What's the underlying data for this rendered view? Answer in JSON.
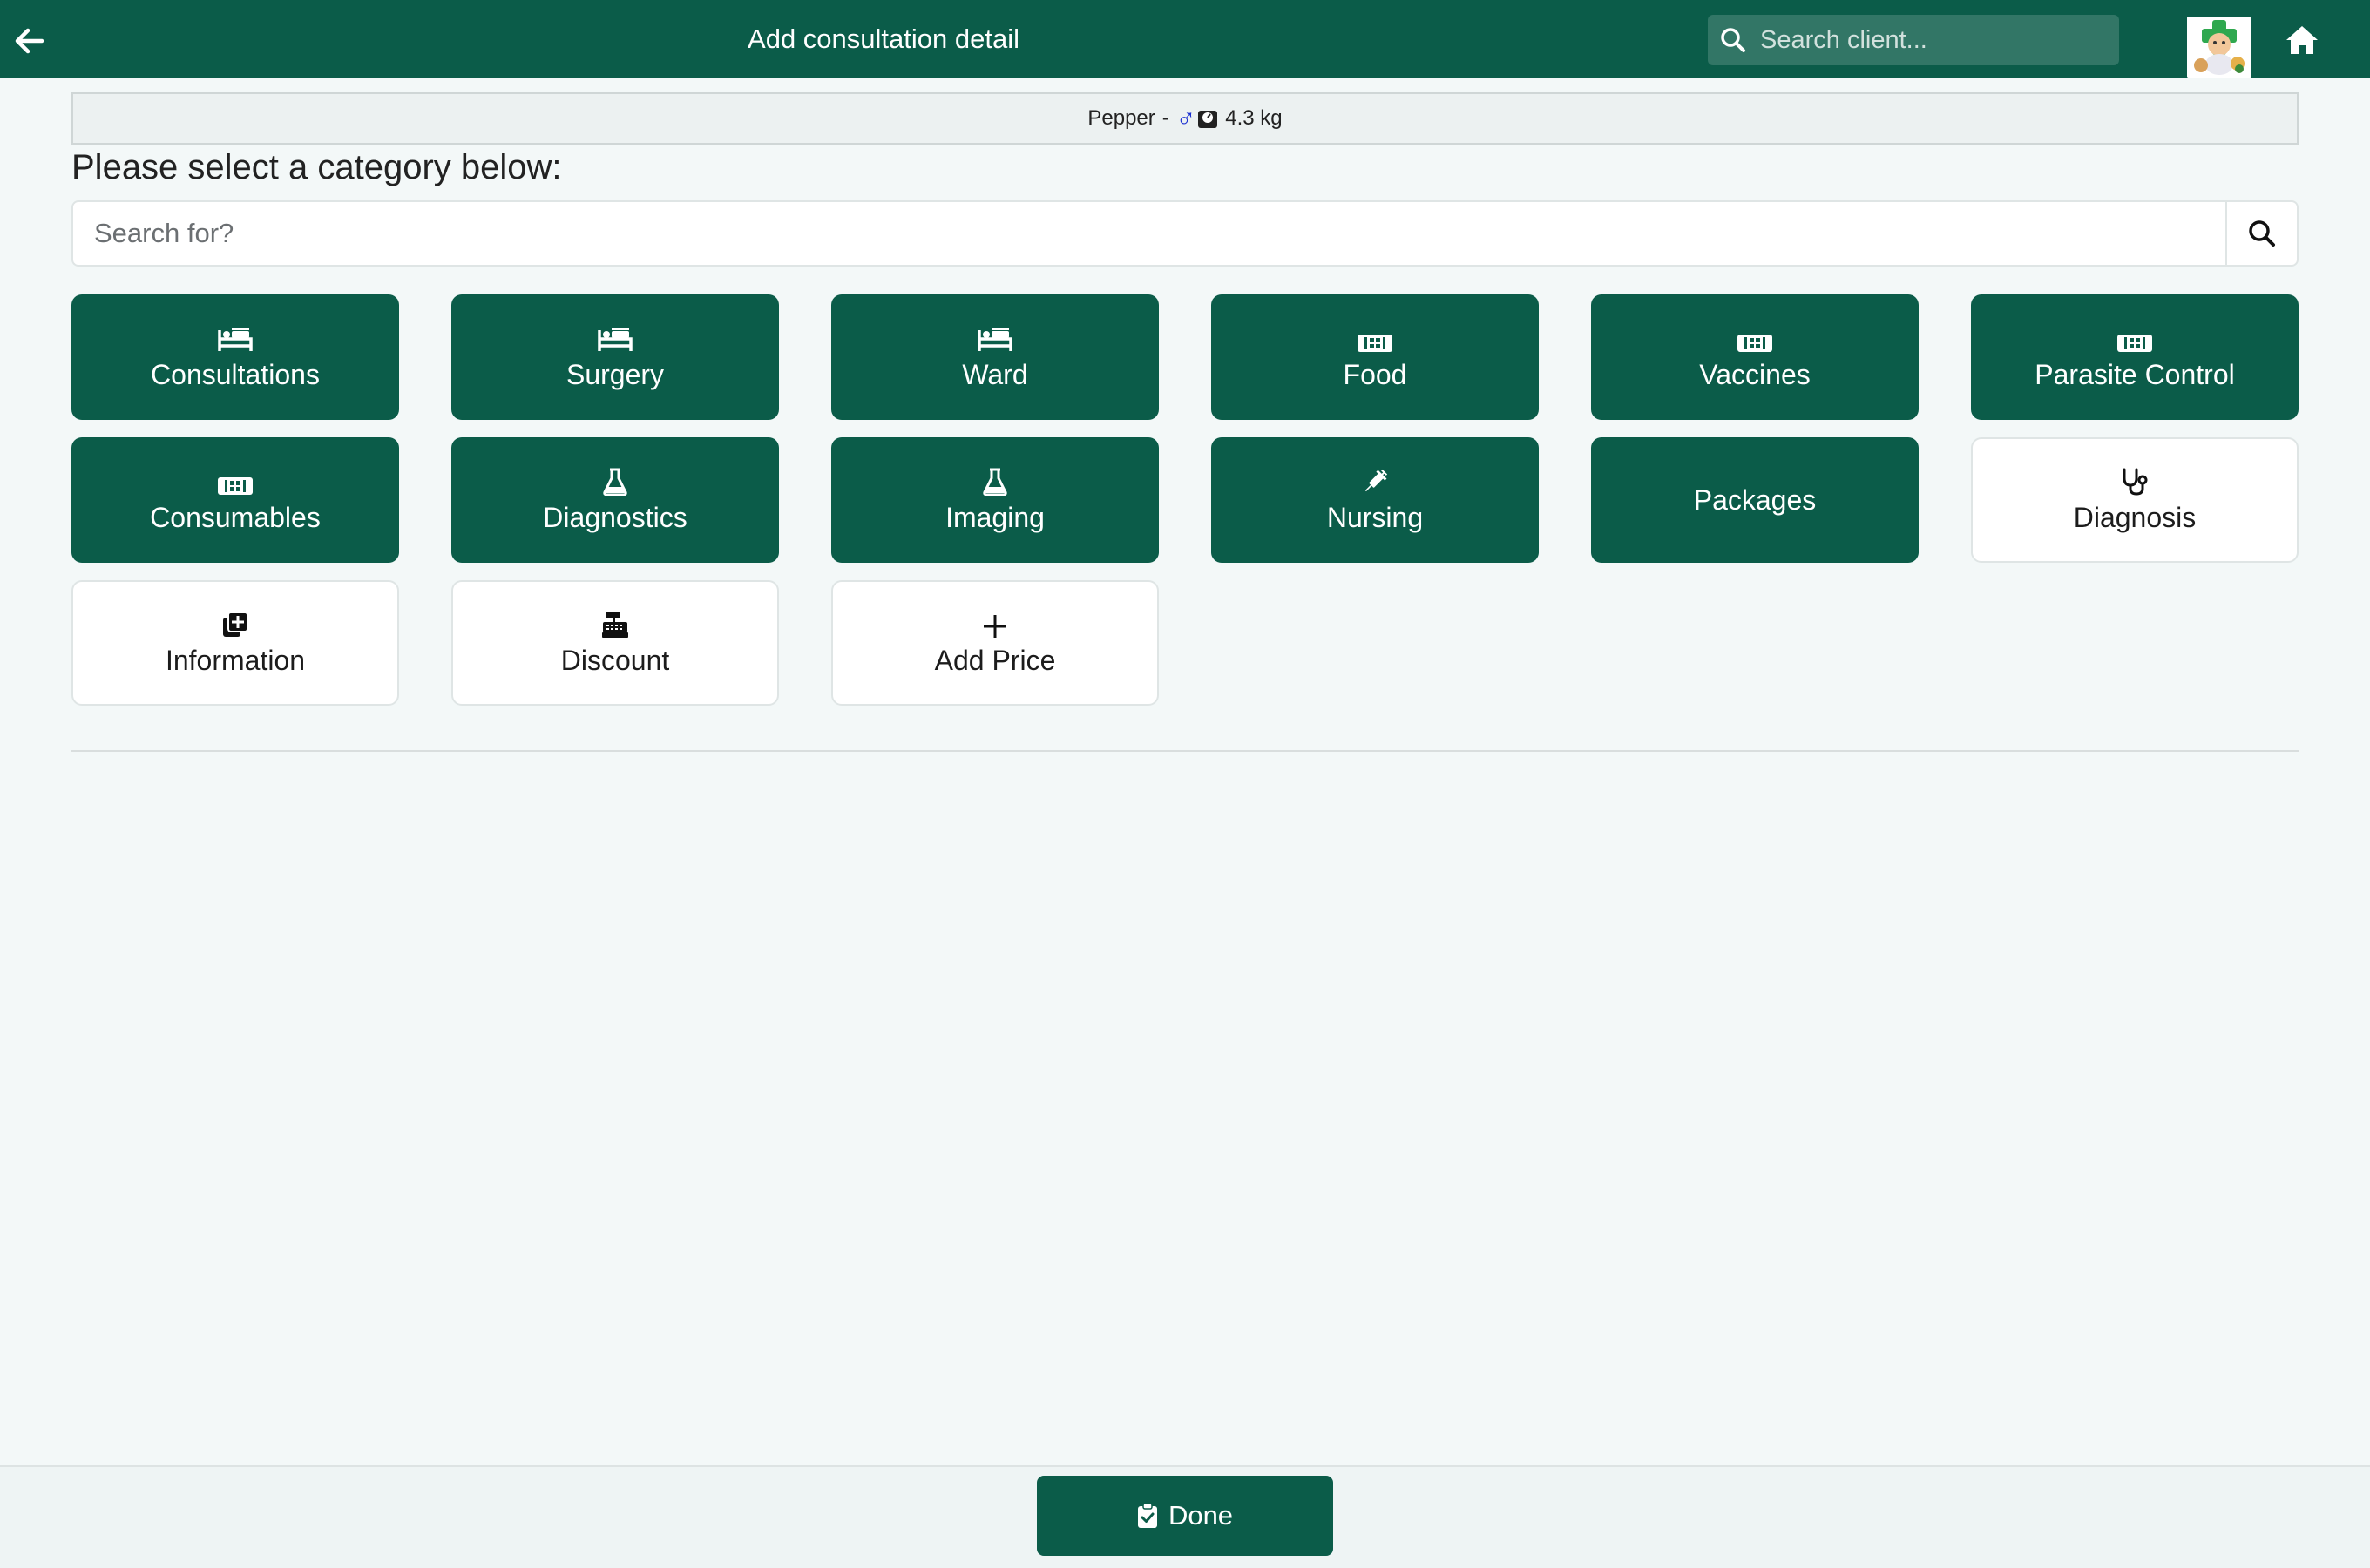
{
  "header": {
    "title": "Add consultation detail",
    "search_placeholder": "Search client...",
    "background_color": "#0b5c49"
  },
  "patient": {
    "name": "Pepper",
    "separator": "-",
    "sex_symbol": "♂",
    "weight": "4.3 kg"
  },
  "heading": "Please select a category below:",
  "search": {
    "placeholder": "Search for?"
  },
  "categories": [
    {
      "label": "Consultations",
      "icon": "bed-icon",
      "style": "primary"
    },
    {
      "label": "Surgery",
      "icon": "bed-icon",
      "style": "primary"
    },
    {
      "label": "Ward",
      "icon": "bed-icon",
      "style": "primary"
    },
    {
      "label": "Food",
      "icon": "barcode-icon",
      "style": "primary"
    },
    {
      "label": "Vaccines",
      "icon": "barcode-icon",
      "style": "primary"
    },
    {
      "label": "Parasite Control",
      "icon": "barcode-icon",
      "style": "primary"
    },
    {
      "label": "Consumables",
      "icon": "barcode-icon",
      "style": "primary"
    },
    {
      "label": "Diagnostics",
      "icon": "flask-icon",
      "style": "primary"
    },
    {
      "label": "Imaging",
      "icon": "flask-icon",
      "style": "primary"
    },
    {
      "label": "Nursing",
      "icon": "syringe-icon",
      "style": "primary"
    },
    {
      "label": "Packages",
      "icon": "",
      "style": "primary"
    },
    {
      "label": "Diagnosis",
      "icon": "stethoscope-icon",
      "style": "outline"
    },
    {
      "label": "Information",
      "icon": "notes-plus-icon",
      "style": "outline"
    },
    {
      "label": "Discount",
      "icon": "cash-register-icon",
      "style": "outline"
    },
    {
      "label": "Add Price",
      "icon": "plus-icon",
      "style": "outline"
    }
  ],
  "footer": {
    "done_label": "Done",
    "done_icon": "clipboard-check-icon"
  }
}
